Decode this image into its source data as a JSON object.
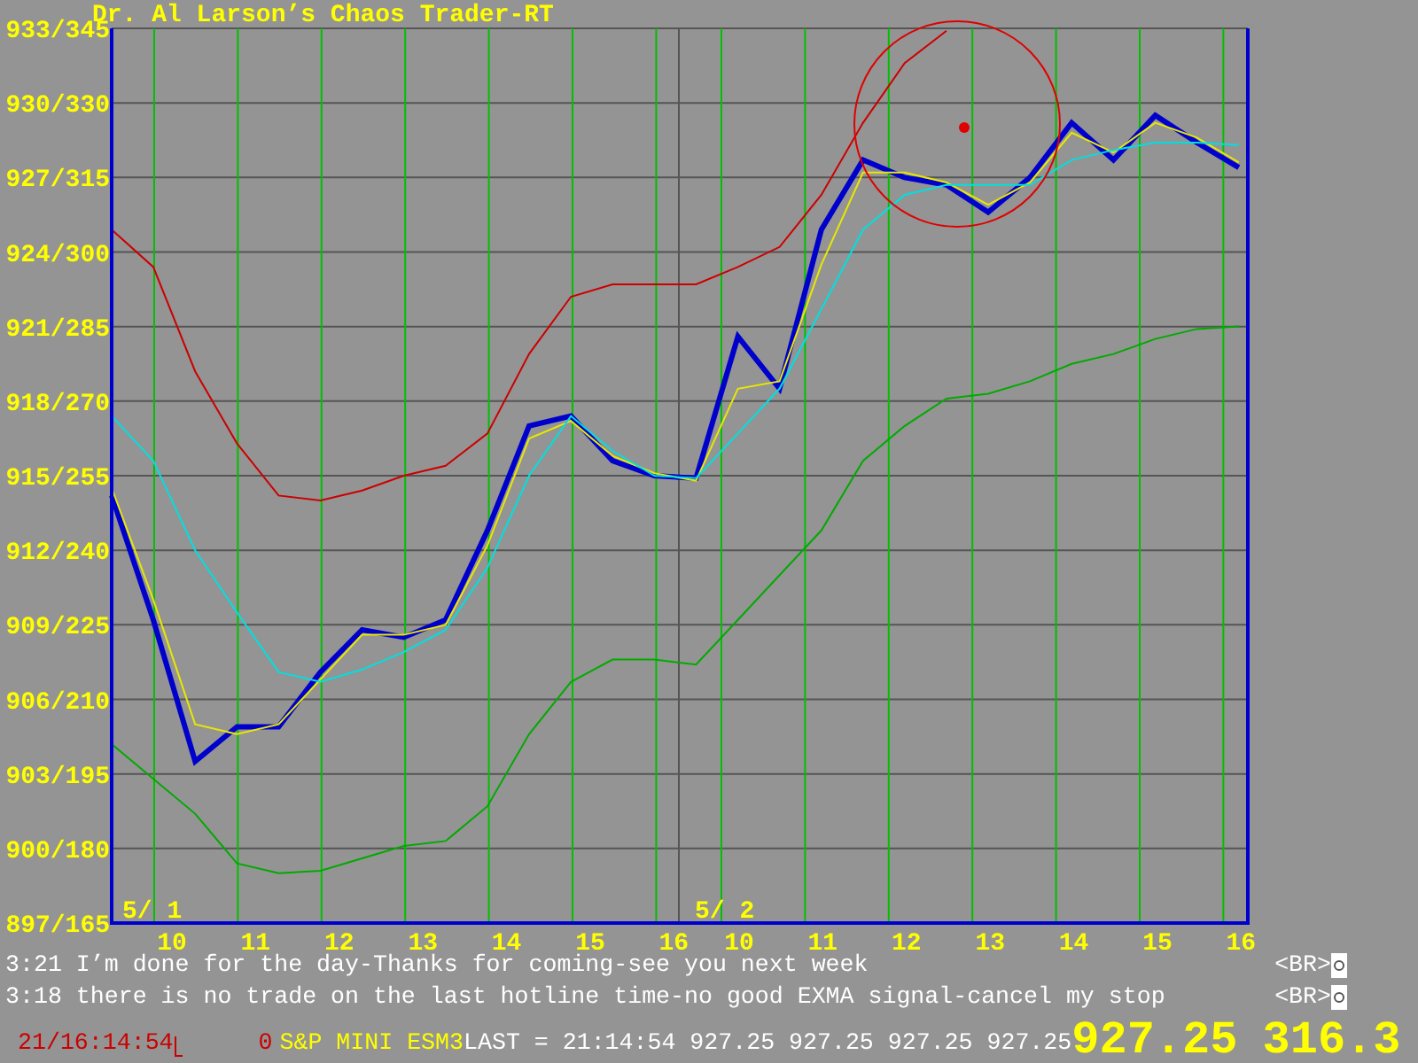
{
  "title": "Dr. Al Larson’s Chaos Trader-RT",
  "chart": {
    "day_labels": [
      "5/ 1",
      "5/ 2"
    ],
    "y_labels": [
      "933/345",
      "930/330",
      "927/315",
      "924/300",
      "921/285",
      "918/270",
      "915/255",
      "912/240",
      "909/225",
      "906/210",
      "903/195",
      "900/180",
      "897/165"
    ],
    "x_labels": [
      "10",
      "11",
      "12",
      "13",
      "14",
      "15",
      "16",
      "10",
      "11",
      "12",
      "13",
      "14",
      "15",
      "16"
    ]
  },
  "messages": [
    {
      "text": "3:21 I’m done for the day-Thanks for coming-see you next week",
      "tag": "<BR>"
    },
    {
      "text": "3:18 there is no trade on the last hotline time-no good EXMA signal-cancel my stop",
      "tag": "<BR>"
    }
  ],
  "status_bar": {
    "datetime": "21/16:14:54",
    "count": "0",
    "symbol": "S&P MINI ESM3",
    "last": "LAST = 21:14:54 927.25 927.25 927.25 927.25",
    "price": "927.25",
    "value": "316.3"
  }
}
